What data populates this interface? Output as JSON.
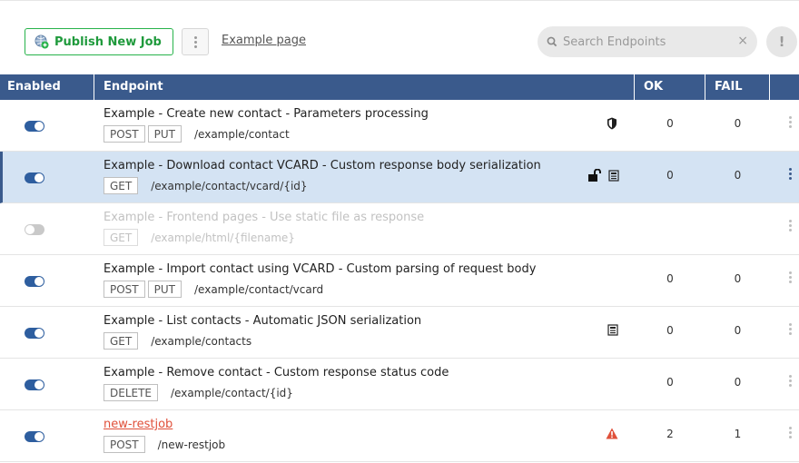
{
  "toolbar": {
    "publish_label": "Publish New Job",
    "example_link": "Example page",
    "search_placeholder": "Search Endpoints",
    "clear_label": "×",
    "alert_label": "!"
  },
  "table": {
    "columns": [
      "Enabled",
      "Endpoint",
      "OK",
      "FAIL"
    ],
    "rows": [
      {
        "title": "Example - Create new contact - Parameters processing",
        "methods": [
          "POST",
          "PUT"
        ],
        "path": "/example/contact",
        "ok": "0",
        "fail": "0",
        "enabled": true,
        "icons": [
          "shield-icon"
        ]
      },
      {
        "title": "Example - Download contact VCARD - Custom response body serialization",
        "methods": [
          "GET"
        ],
        "path": "/example/contact/vcard/{id}",
        "ok": "0",
        "fail": "0",
        "enabled": true,
        "icons": [
          "unlock-icon",
          "file-icon"
        ]
      },
      {
        "title": "Example - Frontend pages - Use static file as response",
        "methods": [
          "GET"
        ],
        "path": "/example/html/{filename}",
        "ok": "",
        "fail": "",
        "enabled": false,
        "icons": []
      },
      {
        "title": "Example - Import contact using VCARD - Custom parsing of request body",
        "methods": [
          "POST",
          "PUT"
        ],
        "path": "/example/contact/vcard",
        "ok": "0",
        "fail": "0",
        "enabled": true,
        "icons": []
      },
      {
        "title": "Example - List contacts - Automatic JSON serialization",
        "methods": [
          "GET"
        ],
        "path": "/example/contacts",
        "ok": "0",
        "fail": "0",
        "enabled": true,
        "icons": [
          "file-icon"
        ]
      },
      {
        "title": "Example - Remove contact - Custom response status code",
        "methods": [
          "DELETE"
        ],
        "path": "/example/contact/{id}",
        "ok": "0",
        "fail": "0",
        "enabled": true,
        "icons": []
      },
      {
        "title": "new-restjob",
        "methods": [
          "POST"
        ],
        "path": "/new-restjob",
        "ok": "2",
        "fail": "1",
        "enabled": true,
        "icons": [
          "warning-icon"
        ]
      }
    ]
  },
  "colors": {
    "header_bg": "#3a5a8c",
    "publish_green": "#27b34a",
    "selected_row": "#d4e3f3",
    "toggle_on": "#2e5e9f",
    "link_red": "#e0503a"
  }
}
